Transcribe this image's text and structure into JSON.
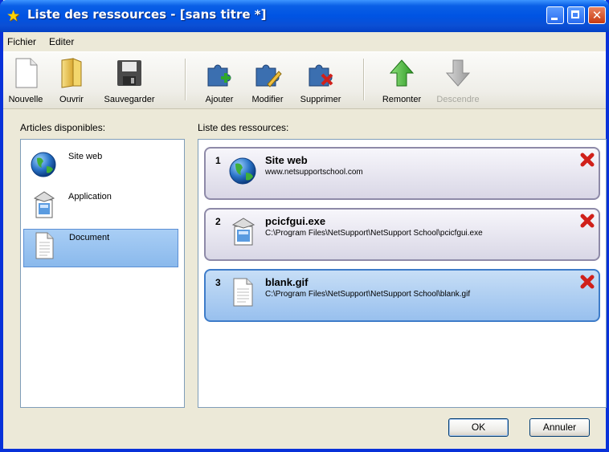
{
  "window": {
    "title": "Liste des ressources - [sans titre *]",
    "close_glyph": "✕"
  },
  "menu": {
    "items": [
      "Fichier",
      "Editer"
    ]
  },
  "toolbar": {
    "new_label": "Nouvelle",
    "open_label": "Ouvrir",
    "save_label": "Sauvegarder",
    "add_label": "Ajouter",
    "edit_label": "Modifier",
    "delete_label": "Supprimer",
    "up_label": "Remonter",
    "down_label": "Descendre"
  },
  "available": {
    "heading": "Articles disponibles:",
    "items": [
      {
        "label": "Site web",
        "icon": "globe-icon"
      },
      {
        "label": "Application",
        "icon": "application-icon"
      },
      {
        "label": "Document",
        "icon": "document-icon",
        "selected": true
      }
    ]
  },
  "resources": {
    "heading": "Liste des ressources:",
    "items": [
      {
        "num": "1",
        "name": "Site web",
        "path": "www.netsupportschool.com",
        "icon": "globe-icon"
      },
      {
        "num": "2",
        "name": "pcicfgui.exe",
        "path": "C:\\Program Files\\NetSupport\\NetSupport School\\pcicfgui.exe",
        "icon": "application-icon"
      },
      {
        "num": "3",
        "name": "blank.gif",
        "path": "C:\\Program Files\\NetSupport\\NetSupport School\\blank.gif",
        "icon": "document-icon",
        "selected": true
      }
    ]
  },
  "buttons": {
    "ok_label": "OK",
    "cancel_label": "Annuler"
  },
  "colors": {
    "accent": "#0054e3",
    "selection": "#98c0ee",
    "delete": "#d0201a"
  }
}
